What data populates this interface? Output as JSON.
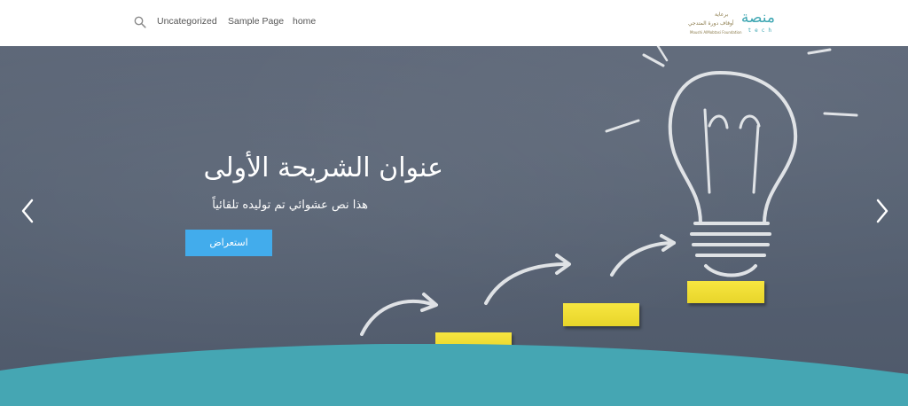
{
  "header": {
    "nav": [
      {
        "label": "Uncategorized"
      },
      {
        "label": "Sample Page"
      },
      {
        "label": "home"
      }
    ],
    "logo": {
      "main": "منصة",
      "tech": "tech",
      "sub_line1": "برعاية",
      "sub_line2": "أوقاف دورة المتدجي",
      "sub_line3": "Moushi AlMobtasi Foundation"
    }
  },
  "hero": {
    "slide": {
      "title": "عنوان الشريحة الأولى",
      "text": "هذا نص عشوائي تم توليده تلقائياً",
      "button_label": "استعراض"
    },
    "colors": {
      "chalkboard": "#566172",
      "button": "#42acec",
      "wave": "#45a6b3",
      "block": "#f2e03a"
    }
  }
}
